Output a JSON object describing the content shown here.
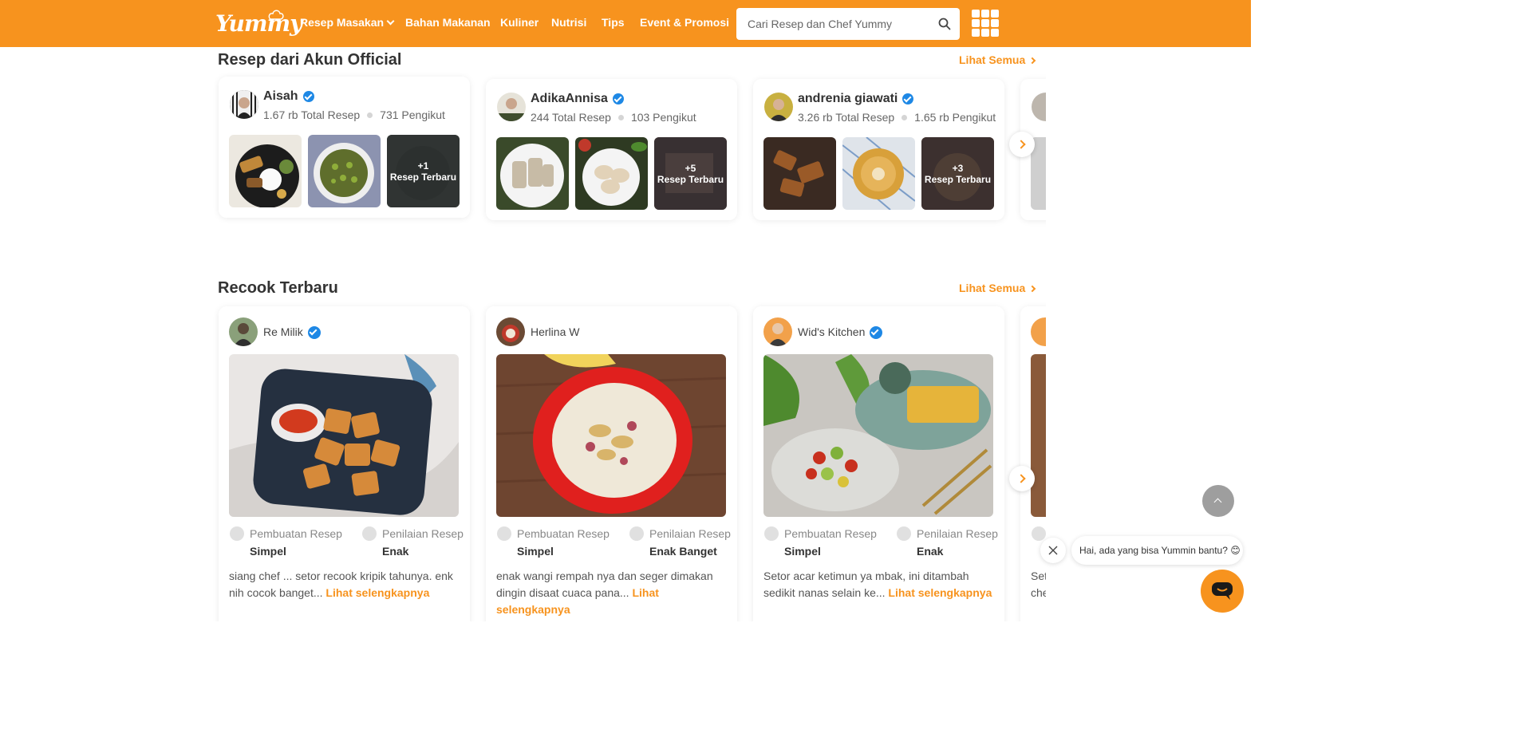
{
  "header": {
    "logo_text": "Yummy",
    "nav": [
      {
        "label": "Resep Masakan",
        "has_dropdown": true
      },
      {
        "label": "Bahan Makanan"
      },
      {
        "label": "Kuliner"
      },
      {
        "label": "Nutrisi"
      },
      {
        "label": "Tips"
      },
      {
        "label": "Event & Promosi"
      }
    ],
    "search_placeholder": "Cari Resep dan Chef Yummy",
    "accent_color": "#f7931e"
  },
  "official_section": {
    "title": "Resep dari Akun Official",
    "see_all": "Lihat Semua",
    "accounts": [
      {
        "name": "Aisah",
        "verified": true,
        "recipes": "1.67 rb Total Resep",
        "followers": "731 Pengikut",
        "more_count": "+1",
        "more_label": "Resep Terbaru"
      },
      {
        "name": "AdikaAnnisa",
        "verified": true,
        "recipes": "244 Total Resep",
        "followers": "103 Pengikut",
        "more_count": "+5",
        "more_label": "Resep Terbaru"
      },
      {
        "name": "andrenia giawati",
        "verified": true,
        "recipes": "3.26 rb Total Resep",
        "followers": "1.65 rb Pengikut",
        "more_count": "+3",
        "more_label": "Resep Terbaru"
      }
    ]
  },
  "recook_section": {
    "title": "Recook Terbaru",
    "see_all": "Lihat Semua",
    "label_making": "Pembuatan Resep",
    "label_rating": "Penilaian Resep",
    "read_more": "Lihat selengkapnya",
    "items": [
      {
        "user": "Re Milik",
        "verified": true,
        "making": "Simpel",
        "rating": "Enak",
        "desc": "siang chef ... setor recook kripik tahunya. enk nih cocok banget..."
      },
      {
        "user": "Herlina W",
        "verified": false,
        "making": "Simpel",
        "rating": "Enak Banget",
        "desc": "enak wangi rempah nya dan seger dimakan dingin disaat cuaca pana..."
      },
      {
        "user": "Wid's Kitchen",
        "verified": true,
        "making": "Simpel",
        "rating": "Enak",
        "desc": "Setor acar ketimun ya mbak, ini ditambah sedikit nanas selain ke..."
      }
    ],
    "partial_desc": "Set che"
  },
  "chat": {
    "message": "Hai, ada yang bisa Yummin bantu? 😊"
  }
}
